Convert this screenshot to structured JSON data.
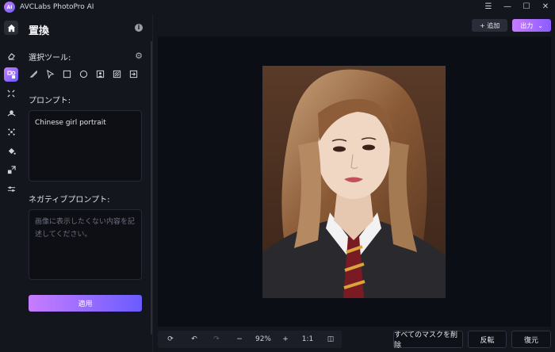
{
  "app": {
    "title": "AVCLabs PhotoPro AI",
    "logo_text": "AI"
  },
  "window_controls": {
    "menu": "☰",
    "minimize": "—",
    "maximize": "☐",
    "close": "✕"
  },
  "rail": [
    "home-icon",
    "eraser-icon",
    "replace-icon",
    "expand-icon",
    "background-icon",
    "stars-icon",
    "fill-icon",
    "resize-icon",
    "adjust-icon"
  ],
  "panel": {
    "title": "置換",
    "selection_tools_label": "選択ツール:",
    "tools": [
      "brush-icon",
      "lasso-icon",
      "rectangle-icon",
      "ellipse-icon",
      "person-icon",
      "pattern-icon",
      "import-icon"
    ],
    "prompt_label": "プロンプト:",
    "prompt_value": "Chinese girl portrait",
    "negative_prompt_label": "ネガティブプロンプト:",
    "negative_prompt_placeholder": "画像に表示したくない内容を記述してください。",
    "apply_label": "適用"
  },
  "toolbar": {
    "add_label": "+ 追加",
    "export_label": "出力",
    "export_chevron": "⌄"
  },
  "bottom": {
    "reset_icon": "⟳",
    "undo_icon": "↶",
    "redo_icon": "↷",
    "zoom_out": "−",
    "zoom_level": "92%",
    "zoom_in": "+",
    "ratio": "1:1",
    "compare_icon": "◫",
    "clear_masks_label": "すべてのマスクを削除",
    "invert_label": "反転",
    "restore_label": "復元"
  },
  "colors": {
    "accent_start": "#c77dff",
    "accent_end": "#6a5cff",
    "background": "#0c0e15",
    "panel": "#14161d"
  }
}
